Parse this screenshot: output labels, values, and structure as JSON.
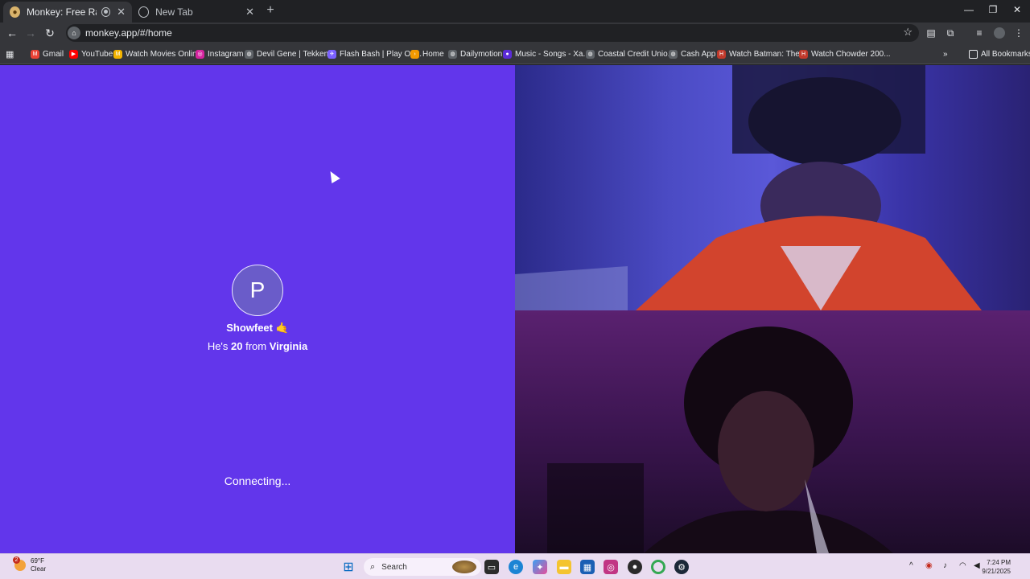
{
  "browser": {
    "tabs": [
      {
        "title": "Monkey: Free Random Vide",
        "active": true
      },
      {
        "title": "New Tab",
        "active": false
      }
    ],
    "url": "monkey.app/#/home",
    "bookmarks": [
      {
        "label": "Gmail",
        "color": "#ea4335",
        "glyph": "M"
      },
      {
        "label": "YouTube",
        "color": "#ff0000",
        "glyph": "▶"
      },
      {
        "label": "Watch Movies Onlin...",
        "color": "#f4b400",
        "glyph": "M"
      },
      {
        "label": "Instagram",
        "color": "#d6249f",
        "glyph": "◎"
      },
      {
        "label": "Devil Gene | Tekken...",
        "color": "#5f6368",
        "glyph": "◍"
      },
      {
        "label": "Flash Bash | Play On...",
        "color": "#7b61ff",
        "glyph": "✈"
      },
      {
        "label": "Home",
        "color": "#f29900",
        "glyph": "›"
      },
      {
        "label": "Dailymotion",
        "color": "#5f6368",
        "glyph": "◍"
      },
      {
        "label": "Music - Songs - Xa...",
        "color": "#5b2bd8",
        "glyph": "●"
      },
      {
        "label": "Coastal Credit Unio...",
        "color": "#5f6368",
        "glyph": "◍"
      },
      {
        "label": "Cash App",
        "color": "#5f6368",
        "glyph": "◍"
      },
      {
        "label": "Watch Batman: The...",
        "color": "#c0392b",
        "glyph": "H"
      },
      {
        "label": "Watch Chowder 200...",
        "color": "#c0392b",
        "glyph": "H"
      }
    ],
    "more_bookmarks": "»",
    "all_bookmarks": "All Bookmarks"
  },
  "page": {
    "avatar_letter": "P",
    "username": "Showfeet 🤙",
    "info_prefix": "He's ",
    "age": "20",
    "info_mid": " from ",
    "location": "Virginia",
    "status": "Connecting..."
  },
  "taskbar": {
    "weather_temp": "69°F",
    "weather_desc": "Clear",
    "weather_badge": "2",
    "search_label": "Search",
    "time": "7:24 PM",
    "date": "9/21/2025"
  }
}
